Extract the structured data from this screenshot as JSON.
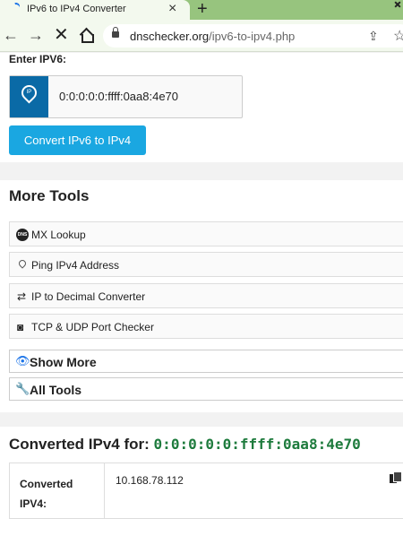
{
  "browser": {
    "tab_title": "IPv6 to IPv4 Converter",
    "tab_close": "×",
    "new_tab": "+",
    "url_host": "dnschecker.org",
    "url_path": "/ipv6-to-ipv4.php",
    "icons": [
      "back-icon",
      "forward-icon",
      "stop-icon",
      "home-icon",
      "lock-icon",
      "share-icon",
      "star-icon"
    ]
  },
  "converter": {
    "label": "Enter IPV6:",
    "input_icon_text": "IP",
    "input_value": "0:0:0:0:0:ffff:0aa8:4e70",
    "button_label": "Convert IPv6 to IPv4",
    "accent_color": "#1aa7e1"
  },
  "more_tools": {
    "title": "More Tools",
    "items": [
      {
        "label": "MX Lookup",
        "icon": "dns-icon",
        "icon_text": "DNS"
      },
      {
        "label": "Ping IPv4 Address",
        "icon": "location-pin-icon"
      },
      {
        "label": "IP to Decimal Converter",
        "icon": "swap-arrows-icon"
      },
      {
        "label": "TCP & UDP Port Checker",
        "icon": "port-icon"
      }
    ],
    "show_more": {
      "label": "Show More",
      "icon": "eye-icon"
    },
    "all_tools": {
      "label": "All Tools",
      "icon": "wrench-icon"
    }
  },
  "result": {
    "title_prefix": "Converted IPv4 for: ",
    "title_ip": "0:0:0:0:0:ffff:0aa8:4e70",
    "title_ip_color": "#1e7b3d",
    "row_label_line1": "Converted",
    "row_label_line2": "IPV4:",
    "row_value": "10.168.78.112",
    "copy_icon": "copy-icon"
  }
}
